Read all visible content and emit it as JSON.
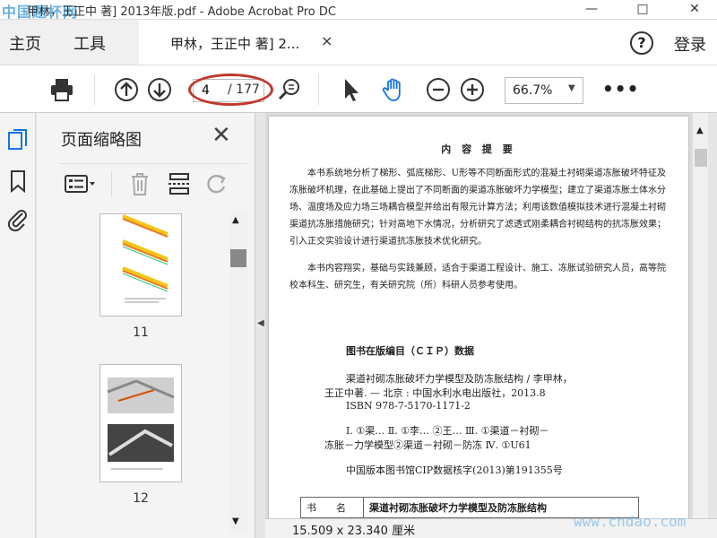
{
  "window": {
    "title": "甲林，王正中 著] 2013年版.pdf - Adobe Acrobat Pro DC",
    "watermark_tl": "中国题杯网",
    "minimize": "—",
    "maximize": "□",
    "close": "✕"
  },
  "menubar": {
    "home": "主页",
    "tools": "工具",
    "tab_title": "甲林，王正中 著] 2...",
    "tab_close": "×",
    "help": "?",
    "login": "登录"
  },
  "toolbar": {
    "current_page": "4",
    "total_pages": "/ 177",
    "zoom": "66.7%",
    "zoom_caret": "▼",
    "more": "•••"
  },
  "panel": {
    "title": "页面缩略图",
    "close": "✕",
    "thumbnails": [
      {
        "label": "11"
      },
      {
        "label": "12"
      }
    ]
  },
  "document": {
    "heading": "内 容 提 要",
    "para1": "本书系统地分析了梯形、弧底梯形、U形等不同断面形式的混凝土衬砌渠道冻胀破坏特征及冻胀破坏机理，在此基础上提出了不同断面的渠道冻胀破坏力学模型；建立了渠道冻胀土体水分场、温度场及应力场三场耦合模型并给出有限元计算方法；利用该数值模拟技术进行混凝土衬砌渠道抗冻胀措施研究；针对高地下水情况，分析研究了滤透式刚柔耦合衬砌结构的抗冻胀效果；引入正交实验设计进行渠道抗冻胀技术优化研究。",
    "para2": "本书内容翔实，基础与实践兼顾，适合于渠道工程设计、施工、冻胀试验研究人员，高等院校本科生、研究生，有关研究院（所）科研人员参考使用。",
    "cip_title": "图书在版编目（ＣＩＰ）数据",
    "cip_line1": "渠道衬砌冻胀破坏力学模型及防冻胀结构 / 李甲林，",
    "cip_line2": "王正中著. — 北京 : 中国水利水电出版社，2013.8",
    "cip_line3": "ISBN 978-7-5170-1171-2",
    "cip_line4": "Ⅰ. ①渠… Ⅱ. ①李… ②王… Ⅲ. ①渠道－衬砌－",
    "cip_line5": "冻胀－力学模型②渠道－衬砌－防冻 Ⅳ. ①U61",
    "cip_line6": "中国版本图书馆CIP数据核字(2013)第191355号",
    "table_key": "书　　名",
    "table_value": "渠道衬砌冻胀破坏力学模型及防冻胀结构"
  },
  "status": {
    "dimensions": "15.509 x 23.340 厘米",
    "watermark": "www.cndao.com"
  },
  "colors": {
    "annotation_oval": "#c0392b",
    "accent": "#1473e6"
  }
}
